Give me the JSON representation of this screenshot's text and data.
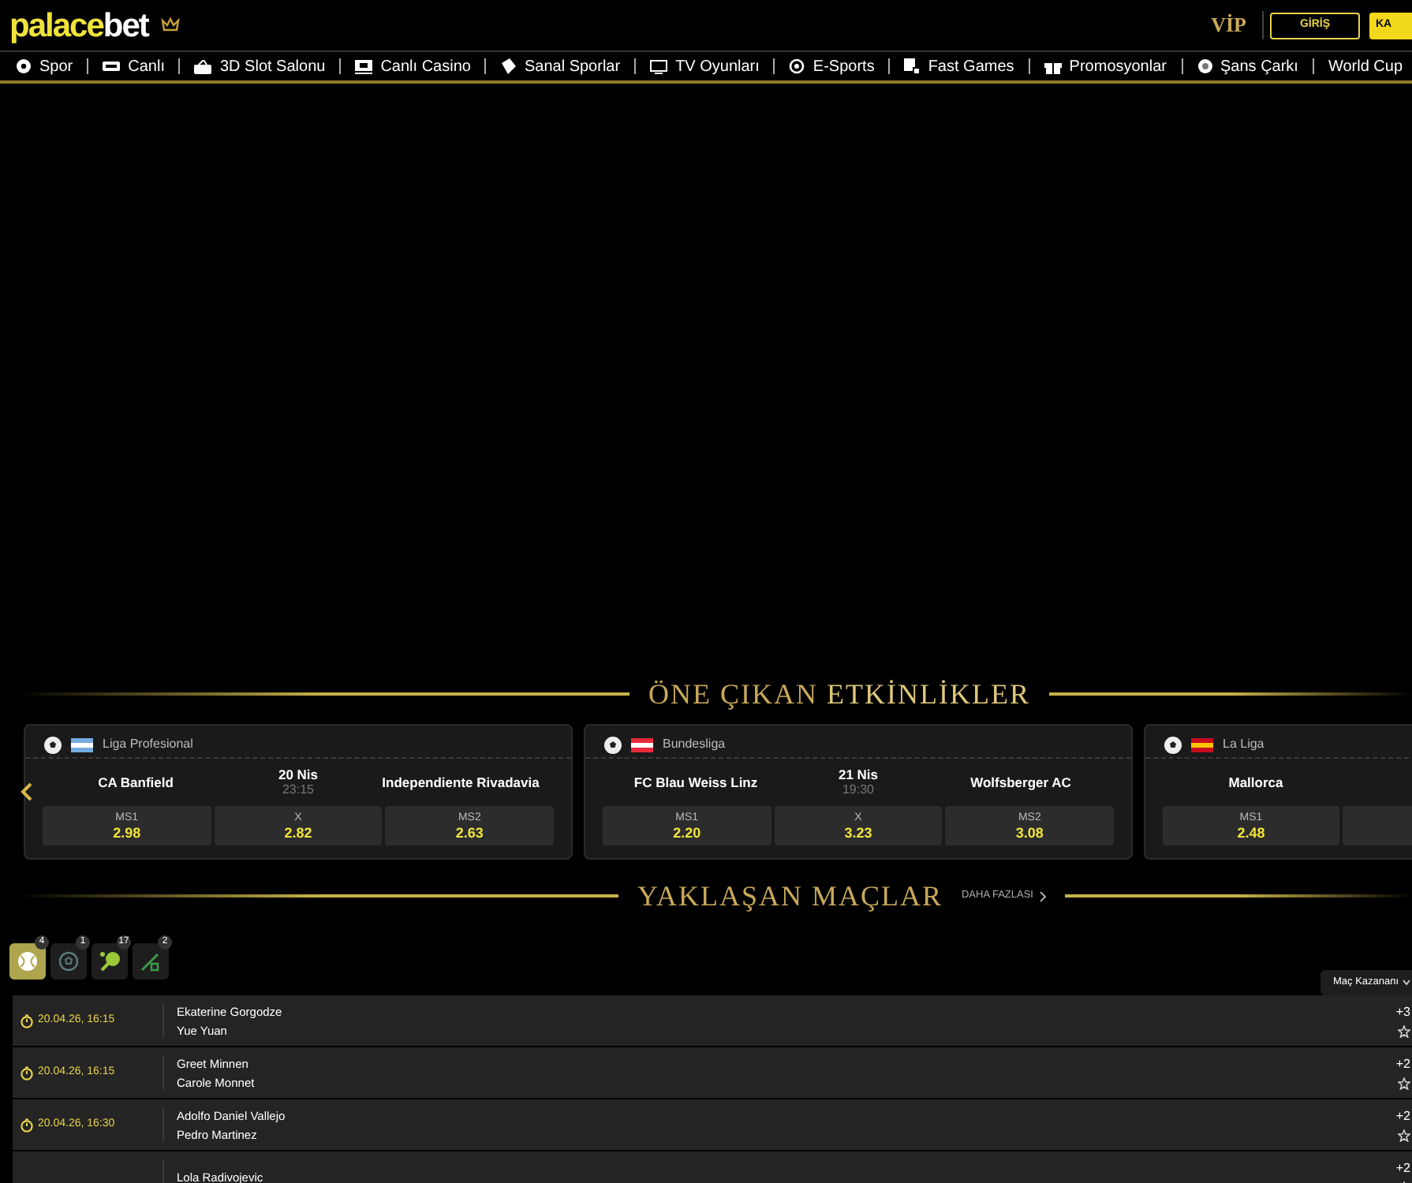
{
  "header": {
    "logo": {
      "part_1": "palace",
      "part_2": "bet"
    },
    "vip": "VİP",
    "login_button": "GİRİŞ",
    "register_button": "KA"
  },
  "nav": [
    {
      "label": "Spor"
    },
    {
      "label": "Canlı"
    },
    {
      "label": "3D Slot Salonu"
    },
    {
      "label": "Canlı Casino"
    },
    {
      "label": "Sanal Sporlar"
    },
    {
      "label": "TV Oyunları"
    },
    {
      "label": "E-Sports"
    },
    {
      "label": "Fast Games"
    },
    {
      "label": "Promosyonlar"
    },
    {
      "label": "Şans Çarkı"
    },
    {
      "label": "World Cup"
    }
  ],
  "featured": {
    "title_1": "ÖNE ÇIKAN",
    "title_2": "ETKİNLİKLER",
    "events": [
      {
        "league": "Liga Profesional",
        "home": "CA Banfield",
        "date": "20 Nis",
        "time": "23:15",
        "away": "Independiente Rivadavia",
        "odds": [
          {
            "label": "MS1",
            "value": "2.98"
          },
          {
            "label": "X",
            "value": "2.82"
          },
          {
            "label": "MS2",
            "value": "2.63"
          }
        ]
      },
      {
        "league": "Bundesliga",
        "home": "FC Blau Weiss Linz",
        "date": "21 Nis",
        "time": "19:30",
        "away": "Wolfsberger AC",
        "odds": [
          {
            "label": "MS1",
            "value": "2.20"
          },
          {
            "label": "X",
            "value": "3.23"
          },
          {
            "label": "MS2",
            "value": "3.08"
          }
        ]
      },
      {
        "league": "La Liga",
        "home": "Mallorca",
        "odds": [
          {
            "label": "MS1",
            "value": "2.48"
          }
        ]
      }
    ]
  },
  "upcoming": {
    "title": "YAKLAŞAN MAÇLAR",
    "more_link": "DAHA FAZLASI",
    "sports": [
      {
        "count": "4",
        "selected": true
      },
      {
        "count": "1",
        "selected": false
      },
      {
        "count": "17",
        "selected": false
      },
      {
        "count": "2",
        "selected": false
      }
    ],
    "market_dropdown": "Maç Kazananı",
    "matches": [
      {
        "time": "20.04.26, 16:15",
        "home": "Ekaterine Gorgodze",
        "away": "Yue Yuan",
        "more": "+3"
      },
      {
        "time": "20.04.26, 16:15",
        "home": "Greet Minnen",
        "away": "Carole Monnet",
        "more": "+2"
      },
      {
        "time": "20.04.26, 16:30",
        "home": "Adolfo Daniel Vallejo",
        "away": "Pedro Martinez",
        "more": "+2"
      },
      {
        "home": "Lola Radivojevic",
        "more": "+2"
      }
    ]
  }
}
